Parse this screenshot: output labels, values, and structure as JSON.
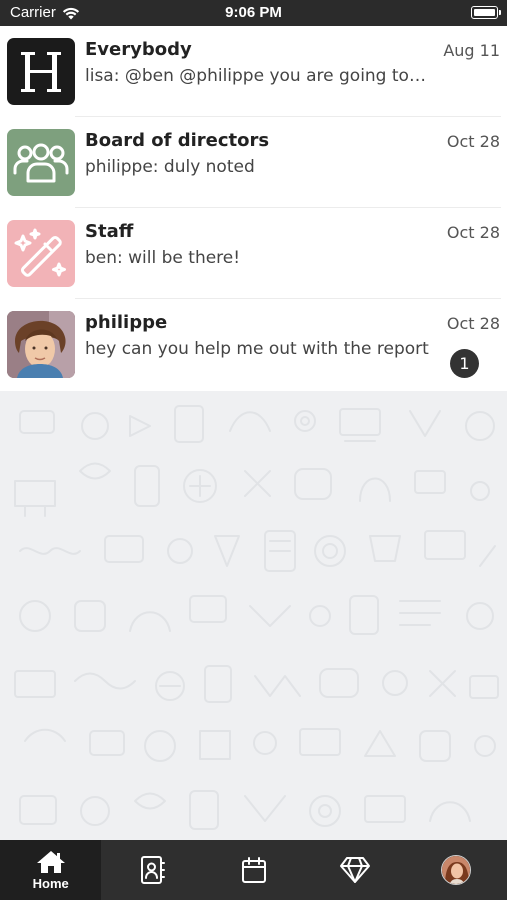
{
  "status_bar": {
    "carrier": "Carrier",
    "time": "9:06 PM"
  },
  "chats": [
    {
      "name": "Everybody",
      "date": "Aug 11",
      "preview": "lisa: @ben @philippe you are going to like this",
      "avatar": "H",
      "avatar_color": "#1b1b1b"
    },
    {
      "name": "Board of directors",
      "date": "Oct 28",
      "preview": "philippe: duly noted",
      "avatar": "group-icon",
      "avatar_color": "#7ea07e"
    },
    {
      "name": "Staff",
      "date": "Oct 28",
      "preview": "ben: will be there!",
      "avatar": "magic-wand-icon",
      "avatar_color": "#f2b3b7"
    },
    {
      "name": "philippe",
      "date": "Oct 28",
      "preview": "hey can you help me out with the report",
      "avatar": "user-photo",
      "unread": "1"
    }
  ],
  "tabs": [
    {
      "label": "Home",
      "icon": "home-icon",
      "active": true
    },
    {
      "label": "",
      "icon": "contacts-icon",
      "active": false
    },
    {
      "label": "",
      "icon": "calendar-icon",
      "active": false
    },
    {
      "label": "",
      "icon": "diamond-icon",
      "active": false
    },
    {
      "label": "",
      "icon": "profile-avatar",
      "active": false
    }
  ]
}
